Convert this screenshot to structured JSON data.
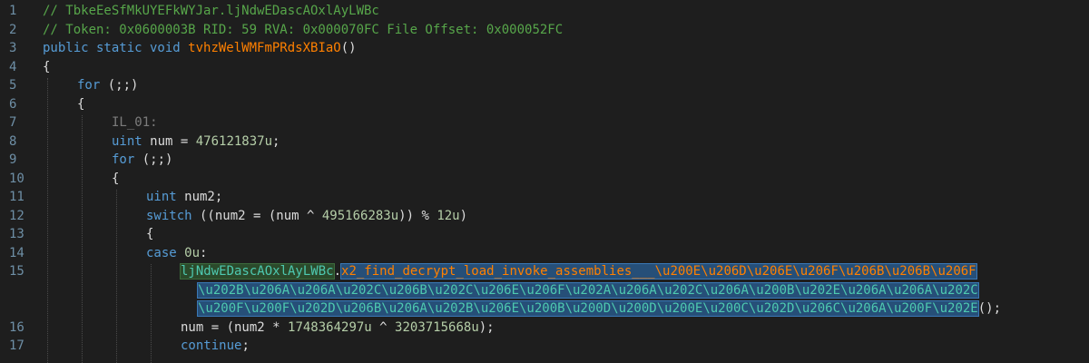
{
  "lines": [
    {
      "n": "1",
      "comment": "// TbkeEeSfMkUYEFkWYJar.ljNdwEDascAOxlAyLWBc"
    },
    {
      "n": "2",
      "comment": "// Token: 0x0600003B RID: 59 RVA: 0x000070FC File Offset: 0x000052FC"
    },
    {
      "n": "3",
      "kw1": "public static void",
      "fn": "tvhzWelWMFmPRdsXBIaO",
      "tail": "()"
    },
    {
      "n": "4",
      "text": "{"
    },
    {
      "n": "5",
      "kw": "for",
      "text": " (;;)"
    },
    {
      "n": "6",
      "text": "{"
    },
    {
      "n": "7",
      "label": "IL_01:"
    },
    {
      "n": "8",
      "kw": "uint",
      "pre": " num = ",
      "num": "476121837u",
      "post": ";"
    },
    {
      "n": "9",
      "kw": "for",
      "text": " (;;)"
    },
    {
      "n": "10",
      "text": "{"
    },
    {
      "n": "11",
      "kw": "uint",
      "text": " num2;"
    },
    {
      "n": "12",
      "kw": "switch",
      "pre": " ((num2 = (num ^ ",
      "num": "495166283u",
      "mid": ")) % ",
      "num2": "12u",
      "post": ")"
    },
    {
      "n": "13",
      "text": "{"
    },
    {
      "n": "14",
      "kw": "case",
      "pre": " ",
      "num": "0u",
      "post": ":"
    },
    {
      "n": "15",
      "cls": "ljNdwEDascAOxlAyLWBc",
      "dot": ".",
      "member": "x2_find_decrypt_load_invoke_assemblies___\\u200E\\u206D\\u206E\\u206F\\u206B\\u206B\\u206F",
      "cont1": "\\u202B\\u206A\\u206A\\u202C\\u206B\\u202C\\u206E\\u206F\\u202A\\u206A\\u202C\\u206A\\u200B\\u202E\\u206A\\u206A\\u202C",
      "cont2": "\\u200F\\u200F\\u202D\\u206B\\u206A\\u202B\\u206E\\u200B\\u200D\\u200D\\u200E\\u200C\\u202D\\u206C\\u206A\\u200F\\u202E",
      "end": "();"
    },
    {
      "n": "16",
      "pre": "num = (num2 * ",
      "num": "1748364297u",
      "mid": " ^ ",
      "num2": "3203715668u",
      "post": ");"
    },
    {
      "n": "17",
      "kw": "continue",
      "post": ";"
    }
  ],
  "colors": {
    "background": "#1e1e1e",
    "comment": "#57a64a",
    "keyword": "#569cd6",
    "method": "#ff8000",
    "number": "#b5cea8",
    "type": "#4ec9b0",
    "line_number": "#6e8fa6"
  }
}
